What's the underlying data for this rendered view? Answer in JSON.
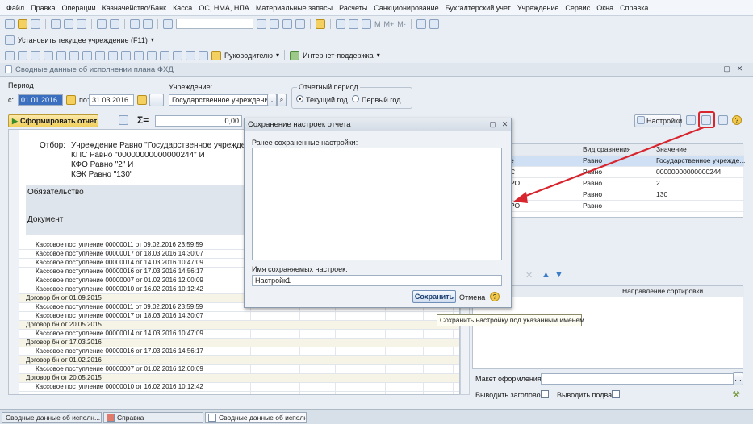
{
  "menu": [
    "Файл",
    "Правка",
    "Операции",
    "Казначейство/Банк",
    "Касса",
    "ОС, НМА, НПА",
    "Материальные запасы",
    "Расчеты",
    "Санкционирование",
    "Бухгалтерский учет",
    "Учреждение",
    "Сервис",
    "Окна",
    "Справка"
  ],
  "toolbar2": {
    "set_institution": "Установить текущее учреждение (F11)",
    "letters": [
      "M",
      "M+",
      "M-"
    ]
  },
  "toolbar3": {
    "director": "Руководителю",
    "support": "Интернет-поддержка"
  },
  "window": {
    "title": "Сводные данные об исполнении плана ФХД"
  },
  "period": {
    "label": "Период",
    "from_label": "с:",
    "from": "01.01.2016",
    "to_label": "по:",
    "to": "31.03.2016",
    "ellipsis": "..."
  },
  "institution": {
    "label": "Учреждение:",
    "value": "Государственное учреждение"
  },
  "report_period": {
    "label": "Отчетный период",
    "current": "Текущий год",
    "first": "Первый год"
  },
  "actions": {
    "generate": "Сформировать отчет",
    "sigma": "Σ=",
    "sum_value": "0,00",
    "settings": "Настройки"
  },
  "report": {
    "filter_label": "Отбор:",
    "filter_lines": [
      "Учреждение Равно \"Государственное учреждение",
      "КПС Равно \"00000000000000244\" И",
      "КФО Равно \"2\" И",
      "КЭК Равно \"130\""
    ],
    "obligation": "Обязательство",
    "document": "Документ",
    "rows": [
      {
        "text": "Кассовое поступление 00000011 от 09.02.2016 23:59:59",
        "grp": false
      },
      {
        "text": "Кассовое поступление 00000017 от 18.03.2016 14:30:07",
        "grp": false
      },
      {
        "text": "Кассовое поступление 00000014 от 14.03.2016 10:47:09",
        "grp": false
      },
      {
        "text": "Кассовое поступление 00000016 от 17.03.2016 14:56:17",
        "grp": false
      },
      {
        "text": "Кассовое поступление 00000007 от 01.02.2016 12:00:09",
        "grp": false
      },
      {
        "text": "Кассовое поступление 00000010 от 16.02.2016 10:12:42",
        "grp": false
      },
      {
        "text": "Договор бн от 01.09.2015",
        "grp": true
      },
      {
        "text": "Кассовое поступление 00000011 от 09.02.2016 23:59:59",
        "grp": false
      },
      {
        "text": "Кассовое поступление 00000017 от 18.03.2016 14:30:07",
        "grp": false
      },
      {
        "text": "Договор бн от 20.05.2015",
        "grp": true
      },
      {
        "text": "Кассовое поступление 00000014 от 14.03.2016 10:47:09",
        "grp": false
      },
      {
        "text": "Договор бн от 17.03.2016",
        "grp": true
      },
      {
        "text": "Кассовое поступление 00000016 от 17.03.2016 14:56:17",
        "grp": false
      },
      {
        "text": "Договор бн от 01.02.2016",
        "grp": true
      },
      {
        "text": "Кассовое поступление 00000007 от 01.02.2016 12:00:09",
        "grp": false
      },
      {
        "text": "Договор бн от 20.05.2015",
        "grp": true
      },
      {
        "text": "Кассовое поступление 00000010 от 16.02.2016 10:12:42",
        "grp": false
      }
    ]
  },
  "filters_table": {
    "headers": [
      "Вид сравнения",
      "Значение"
    ],
    "rows": [
      {
        "field": "е",
        "cmp": "Равно",
        "value": "Государственное учрежде..."
      },
      {
        "field": "С",
        "cmp": "Равно",
        "value": "00000000000000244"
      },
      {
        "field": "РО",
        "cmp": "Равно",
        "value": "2"
      },
      {
        "field": "",
        "cmp": "Равно",
        "value": "130"
      },
      {
        "field": "РО",
        "cmp": "Равно",
        "value": ""
      }
    ]
  },
  "sort_panel": {
    "direction_header": "Направление сортировки"
  },
  "bottom_right": {
    "layout_label": "Макет оформления:",
    "show_header": "Выводить заголовок:",
    "show_footer": "Выводить подвал:"
  },
  "dialog": {
    "title": "Сохранение настроек отчета",
    "saved_label": "Ранее сохраненные настройки:",
    "name_label": "Имя сохраняемых настроек:",
    "name_value": "Настройк1",
    "save": "Сохранить",
    "cancel": "Отмена"
  },
  "tooltip": "Сохранить настройку под указанным именем",
  "taskbar": [
    "Сводные данные об исполн...",
    "Справка",
    "Сводные данные об исполн..."
  ],
  "colors": {
    "accent_red": "#d8262f",
    "generate_btn": "#f5d978"
  }
}
